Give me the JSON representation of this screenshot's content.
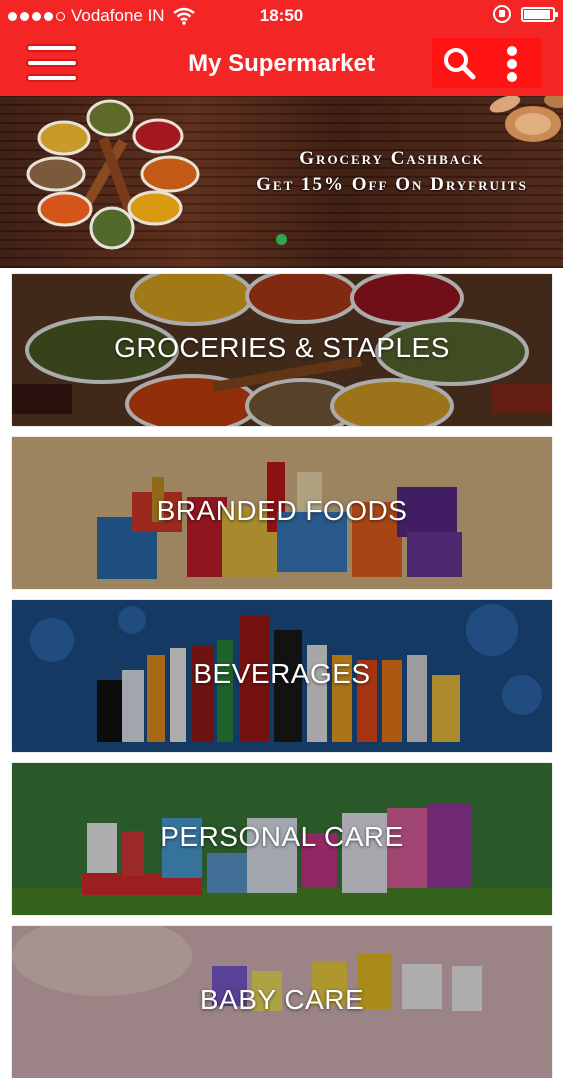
{
  "status_bar": {
    "carrier": "Vodafone IN",
    "time": "18:50",
    "signal_bars": 4,
    "battery_level": 0.92
  },
  "app_bar": {
    "title": "My Supermarket",
    "menu_icon": "hamburger-icon",
    "search_icon": "search-icon",
    "more_icon": "more-vertical-icon"
  },
  "banner": {
    "line1": "Grocery Cashback",
    "line2": "Get 15% Off On Dryfruits",
    "active_page": 1
  },
  "categories": [
    {
      "label": "GROCERIES & STAPLES"
    },
    {
      "label": "BRANDED FOODS"
    },
    {
      "label": "BEVERAGES"
    },
    {
      "label": "PERSONAL CARE"
    },
    {
      "label": "BABY CARE"
    }
  ],
  "colors": {
    "brand_red": "#f42525",
    "action_box_red": "#ff1414",
    "pager_green": "#2fa84f"
  }
}
